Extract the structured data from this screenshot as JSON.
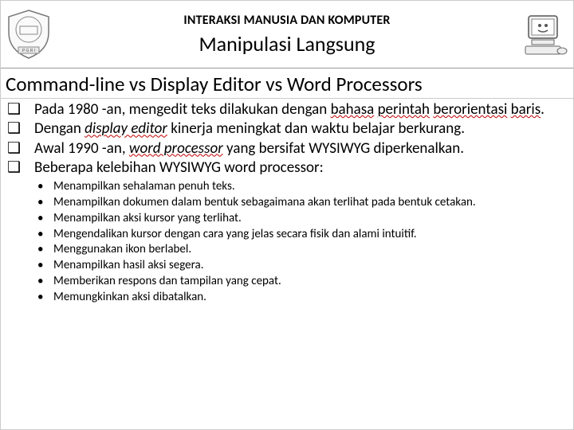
{
  "header": {
    "course": "INTERAKSI MANUSIA DAN KOMPUTER",
    "title": "Manipulasi Langsung"
  },
  "section_title": "Command-line vs Display Editor vs Word Processors",
  "bullets": {
    "b1_pre": "Pada 1980 -an, mengedit teks dilakukan dengan ",
    "b1_u1": "bahasa",
    "b1_sp1": " ",
    "b1_u2": "perintah",
    "b1_sp2": " ",
    "b1_u3": "berorientasi",
    "b1_sp3": " ",
    "b1_u4": "baris",
    "b1_end": ".",
    "b2_pre": "Dengan ",
    "b2_em": "display editor",
    "b2_post": " kinerja meningkat dan waktu belajar berkurang.",
    "b3_pre": "Awal 1990 -an, ",
    "b3_em": "word processor",
    "b3_post": " yang bersifat WYSIWYG diperkenalkan.",
    "b4": "Beberapa kelebihan WYSIWYG word processor:"
  },
  "sub": {
    "s1": "Menampilkan sehalaman penuh teks.",
    "s2": "Menampilkan dokumen dalam bentuk sebagaimana akan terlihat pada bentuk cetakan.",
    "s3": "Menampilkan aksi kursor yang terlihat.",
    "s4": "Mengendalikan kursor dengan cara yang jelas secara fisik dan alami intuitif.",
    "s5": "Menggunakan ikon berlabel.",
    "s6": "Menampilkan hasil aksi segera.",
    "s7": "Memberikan respons dan tampilan yang cepat.",
    "s8": "Memungkinkan aksi dibatalkan."
  },
  "glyph": {
    "box": "❑",
    "dot": "•"
  }
}
